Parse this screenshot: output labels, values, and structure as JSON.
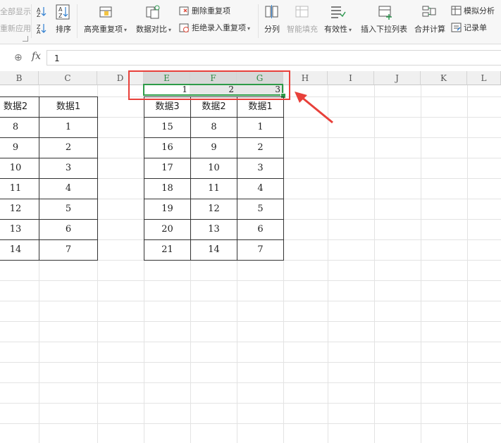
{
  "ribbon": {
    "show_all": "全部显示",
    "reapply": "重新应用",
    "sort": "排序",
    "highlight_dup": "高亮重复项",
    "data_compare": "数据对比",
    "delete_dup": "删除重复项",
    "reject_dup": "拒绝录入重复项",
    "split": "分列",
    "smart_fill": "智能填充",
    "validity": "有效性",
    "insert_dropdown": "插入下拉列表",
    "merge_calc": "合并计算",
    "simulate": "模拟分析",
    "record": "记录单"
  },
  "formula_bar": {
    "fx": "fx",
    "value": "1"
  },
  "columns": [
    "B",
    "C",
    "D",
    "E",
    "F",
    "G",
    "H",
    "I",
    "J",
    "K",
    "L"
  ],
  "selected_values": [
    "1",
    "2",
    "3"
  ],
  "left_table": {
    "headers": [
      "数据2",
      "数据1"
    ],
    "rows": [
      [
        "8",
        "1"
      ],
      [
        "9",
        "2"
      ],
      [
        "10",
        "3"
      ],
      [
        "11",
        "4"
      ],
      [
        "12",
        "5"
      ],
      [
        "13",
        "6"
      ],
      [
        "14",
        "7"
      ]
    ]
  },
  "right_table": {
    "headers": [
      "数据3",
      "数据2",
      "数据1"
    ],
    "rows": [
      [
        "15",
        "8",
        "1"
      ],
      [
        "16",
        "9",
        "2"
      ],
      [
        "17",
        "10",
        "3"
      ],
      [
        "18",
        "11",
        "4"
      ],
      [
        "19",
        "12",
        "5"
      ],
      [
        "20",
        "13",
        "6"
      ],
      [
        "21",
        "14",
        "7"
      ]
    ]
  },
  "colors": {
    "selection": "#2e9b48",
    "annotation": "#e8403a"
  }
}
